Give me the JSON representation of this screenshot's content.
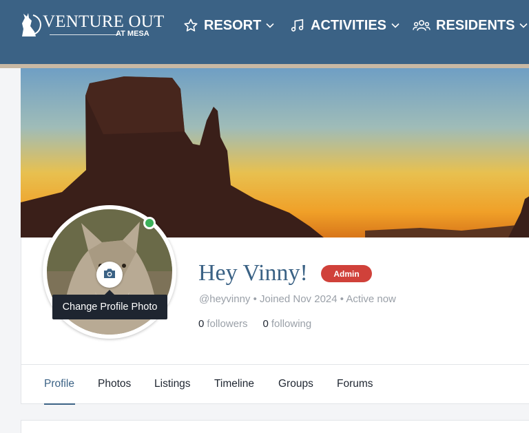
{
  "brand": {
    "title": "VENTURE OUT",
    "subtitle": "AT MESA",
    "logo_icon": "howling-coyote-icon"
  },
  "nav": [
    {
      "label": "RESORT",
      "icon": "star-icon"
    },
    {
      "label": "ACTIVITIES",
      "icon": "music-note-icon"
    },
    {
      "label": "RESIDENTS",
      "icon": "users-icon"
    }
  ],
  "colors": {
    "header": "#3b6285",
    "accent": "#3b6285",
    "badge": "#d0413a",
    "online": "#3cb15a"
  },
  "profile": {
    "greeting": "Hey Vinny!",
    "role_badge": "Admin",
    "meta": "@heyvinny • Joined Nov 2024 • Active now",
    "followers_count": "0",
    "followers_label": "followers",
    "following_count": "0",
    "following_label": "following",
    "change_photo_tooltip": "Change Profile Photo"
  },
  "tabs": [
    {
      "label": "Profile",
      "active": true
    },
    {
      "label": "Photos",
      "active": false
    },
    {
      "label": "Listings",
      "active": false
    },
    {
      "label": "Timeline",
      "active": false
    },
    {
      "label": "Groups",
      "active": false
    },
    {
      "label": "Forums",
      "active": false
    }
  ]
}
